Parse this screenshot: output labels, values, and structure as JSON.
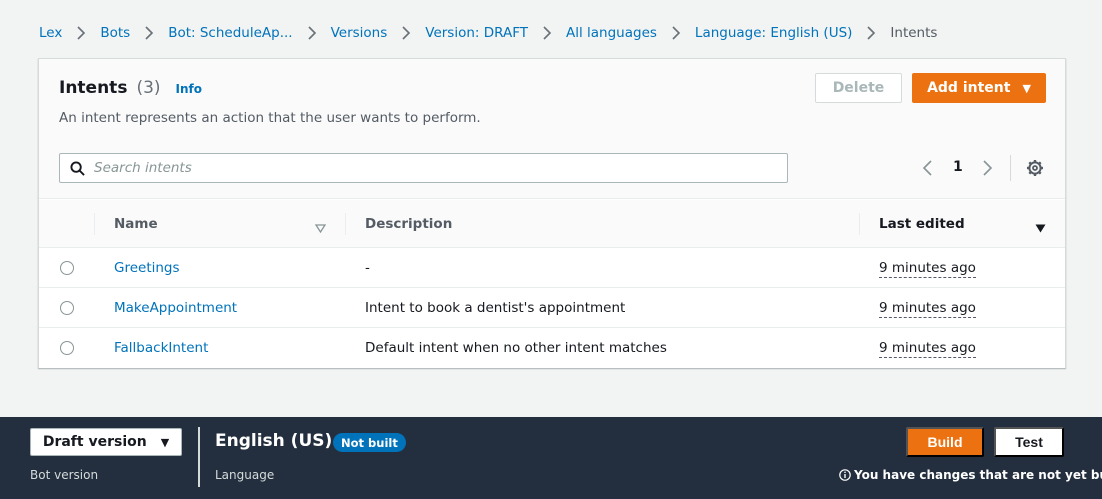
{
  "breadcrumb": [
    {
      "label": "Lex"
    },
    {
      "label": "Bots"
    },
    {
      "label": "Bot: ScheduleAp..."
    },
    {
      "label": "Versions"
    },
    {
      "label": "Version: DRAFT"
    },
    {
      "label": "All languages"
    },
    {
      "label": "Language: English (US)"
    },
    {
      "label": "Intents"
    }
  ],
  "header": {
    "title": "Intents",
    "count": "(3)",
    "info": "Info",
    "description": "An intent represents an action that the user wants to perform.",
    "delete_label": "Delete",
    "add_label": "Add intent"
  },
  "search": {
    "placeholder": "Search intents",
    "value": ""
  },
  "pagination": {
    "current_page": "1"
  },
  "table": {
    "columns": {
      "name": "Name",
      "description": "Description",
      "last_edited": "Last edited"
    },
    "rows": [
      {
        "name": "Greetings",
        "description": "-",
        "last_edited": "9 minutes ago"
      },
      {
        "name": "MakeAppointment",
        "description": "Intent to book a dentist's appointment",
        "last_edited": "9 minutes ago"
      },
      {
        "name": "FallbackIntent",
        "description": "Default intent when no other intent matches",
        "last_edited": "9 minutes ago"
      }
    ]
  },
  "footer": {
    "version_select": "Draft version",
    "version_label": "Bot version",
    "language": "English (US)",
    "language_label": "Language",
    "status_badge": "Not built",
    "build_label": "Build",
    "test_label": "Test",
    "notice": "You have changes that are not yet built."
  },
  "colors": {
    "accent": "#ec7211",
    "link": "#0073bb",
    "footer_bg": "#232f3e",
    "badge": "#0073bb"
  }
}
